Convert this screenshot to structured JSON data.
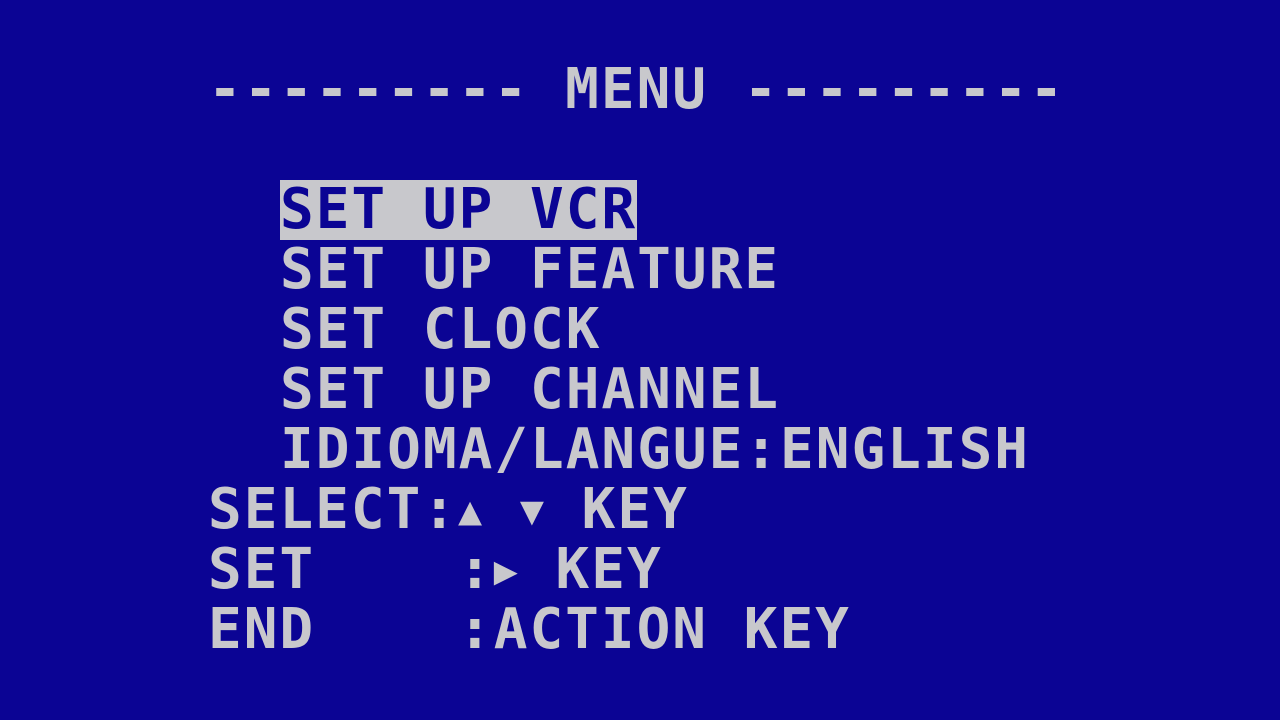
{
  "screen": {
    "background_color": "#0b0494",
    "text_color": "#c8c8cc"
  },
  "menu": {
    "title_left_rule": "---------",
    "title": "MENU",
    "title_right_rule": "---------",
    "selected_index": 0,
    "items": [
      {
        "label": "SET UP VCR"
      },
      {
        "label": "SET UP FEATURE"
      },
      {
        "label": "SET CLOCK"
      },
      {
        "label": "SET UP CHANNEL"
      },
      {
        "label": "IDIOMA/LANGUE:ENGLISH"
      }
    ]
  },
  "hints": {
    "select_label": "SELECT",
    "select_sep": ":",
    "select_up_icon": "up-triangle-icon",
    "select_up_glyph": "▲",
    "select_down_icon": "down-triangle-icon",
    "select_down_glyph": "▼",
    "select_key": "KEY",
    "set_label": "SET",
    "set_sep": ":",
    "set_right_icon": "right-triangle-icon",
    "set_right_glyph": "▶",
    "set_key": "KEY",
    "end_label": "END",
    "end_sep": ":",
    "end_action": "ACTION KEY"
  }
}
